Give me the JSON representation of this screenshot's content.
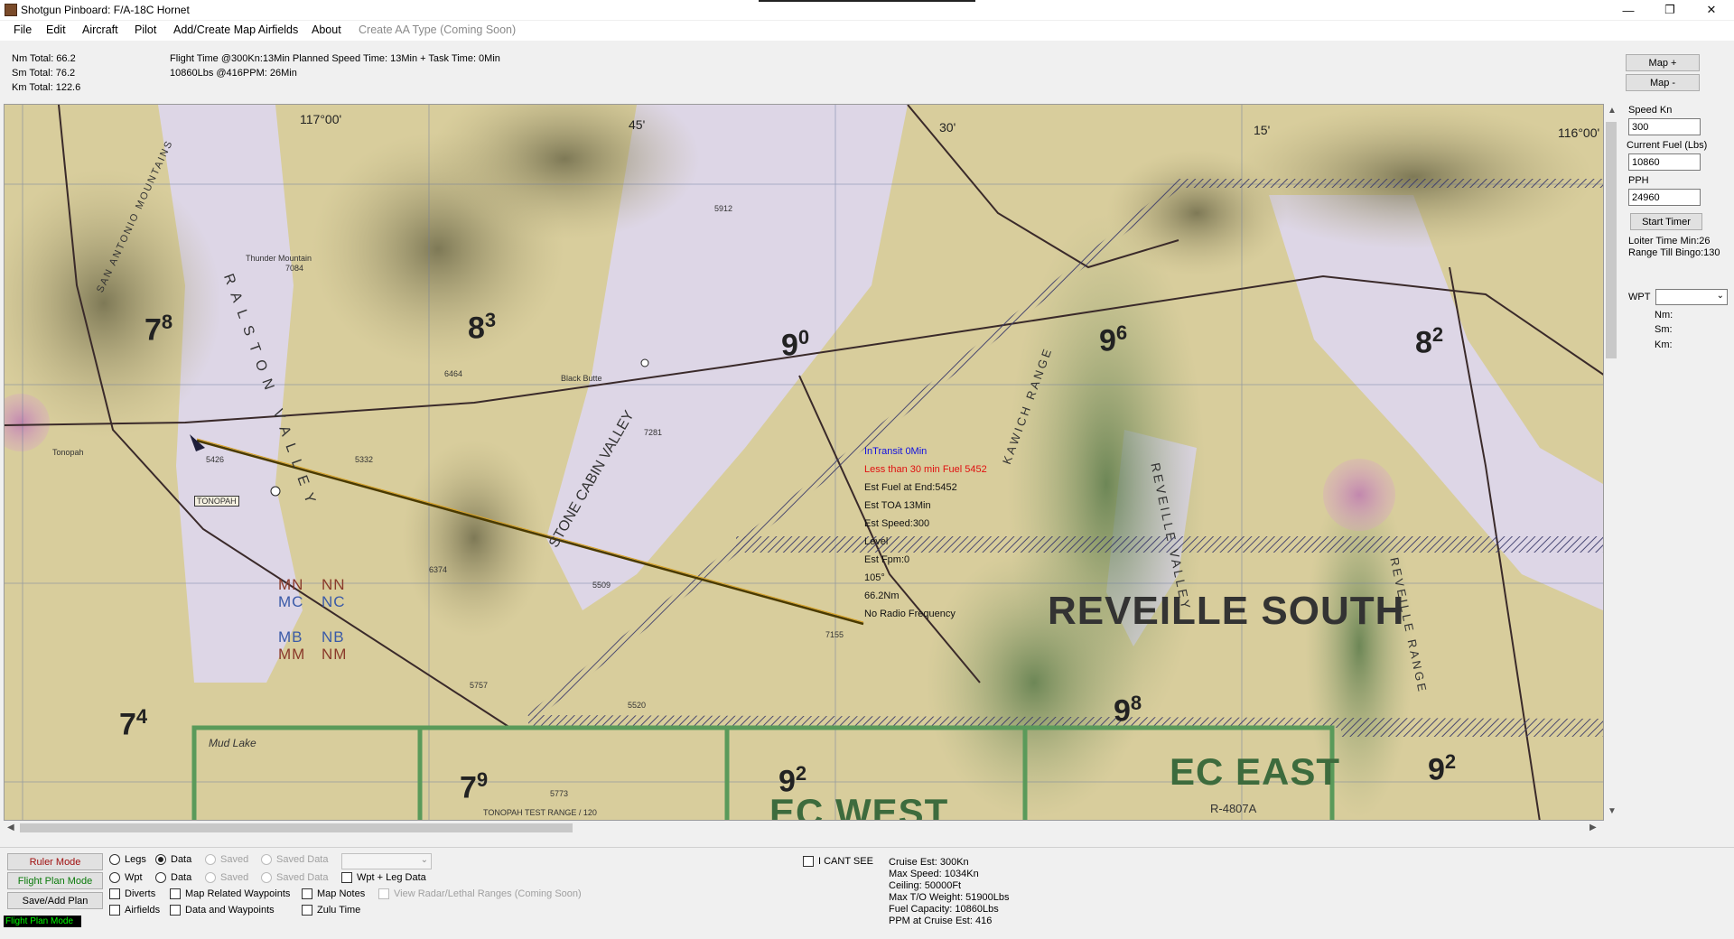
{
  "window": {
    "title": "Shotgun Pinboard: F/A-18C Hornet",
    "minimize": "—",
    "maximize": "❐",
    "close": "✕"
  },
  "menu": {
    "file": "File",
    "edit": "Edit",
    "aircraft": "Aircraft",
    "pilot": "Pilot",
    "airfields": "Add/Create Map Airfields",
    "about": "About",
    "create_aa": "Create AA Type (Coming Soon)"
  },
  "totals": {
    "nm": "Nm Total: 66.2",
    "sm": "Sm Total: 76.2",
    "km": "Km Total: 122.6",
    "flight_time": "Flight Time @300Kn:13Min Planned Speed Time: 13Min + Task Time: 0Min",
    "fuel_line": "10860Lbs @416PPM: 26Min"
  },
  "map": {
    "grid_numbers": [
      {
        "main": "7",
        "sup": "8"
      },
      {
        "main": "8",
        "sup": "3"
      },
      {
        "main": "9",
        "sup": "0"
      },
      {
        "main": "9",
        "sup": "6"
      },
      {
        "main": "8",
        "sup": "2"
      },
      {
        "main": "7",
        "sup": "4"
      },
      {
        "main": "7",
        "sup": "9"
      },
      {
        "main": "9",
        "sup": "2"
      },
      {
        "main": "9",
        "sup": "8"
      },
      {
        "main": "9",
        "sup": "2"
      }
    ],
    "area_reveille": "REVEILLE SOUTH",
    "area_ec_east": "EC EAST",
    "area_ec_west": "EC WEST",
    "restricted": "R-4807A",
    "coord_117": "117°00'",
    "coord_45": "45'",
    "coord_30": "30'",
    "coord_15": "15'",
    "coord_116": "116°00'",
    "tonopah": "TONOPAH",
    "tonopah_town": "Tonopah",
    "mud_lake": "Mud Lake",
    "mn": "MN",
    "nn": "NN",
    "mc": "MC",
    "nc": "NC",
    "mb": "MB",
    "nb": "NB",
    "mm": "MM",
    "nm": "NM",
    "stone_cabin": "STONE CABIN VALLEY",
    "ralston": "RALSTON VALLEY",
    "reveille_valley": "REVEILLE VALLEY",
    "reveille_range": "REVEILLE RANGE",
    "kawich": "KAWICH RANGE",
    "san_antonio": "SAN ANTONIO MOUNTAINS",
    "thunder_mtn": "Thunder Mountain",
    "black_butte": "Black Butte",
    "tonopah_test_range": "TONOPAH TEST RANGE / 120",
    "elev_7084": "7084",
    "elev_6464": "6464",
    "elev_7281": "7281",
    "elev_5332": "5332",
    "elev_5509": "5509",
    "elev_5757": "5757",
    "elev_5520": "5520",
    "elev_5912": "5912",
    "elev_7155": "7155",
    "elev_6374": "6374",
    "elev_5773": "5773",
    "elev_5426": "5426"
  },
  "info_overlay": {
    "in_transit": "InTransit 0Min",
    "fuel_warning": "Less than 30 min Fuel 5452",
    "est_fuel": "Est Fuel at End:5452",
    "est_toa": "Est TOA 13Min",
    "est_speed": "Est Speed:300",
    "level": "Level",
    "est_fpm": "Est Fpm:0",
    "heading": "105°",
    "distance": "66.2Nm",
    "radio": "No Radio Frequency"
  },
  "right_panel": {
    "map_plus": "Map +",
    "map_minus": "Map -",
    "speed_label": "Speed Kn",
    "speed_value": "300",
    "fuel_label": "Current Fuel (Lbs)",
    "fuel_value": "10860",
    "pph_label": "PPH",
    "pph_value": "24960",
    "start_timer": "Start Timer",
    "loiter": "Loiter Time Min:26",
    "range_bingo": "Range Till Bingo:130",
    "wpt_label": "WPT",
    "wpt_nm": "Nm:",
    "wpt_sm": "Sm:",
    "wpt_km": "Km:"
  },
  "bottom": {
    "ruler_mode": "Ruler Mode",
    "flight_plan_mode": "Flight Plan Mode",
    "save_add_plan": "Save/Add Plan",
    "status_mode": "Flight Plan Mode",
    "legs": "Legs",
    "data1": "Data",
    "saved1": "Saved",
    "saved_data1": "Saved Data",
    "wpt": "Wpt",
    "data2": "Data",
    "saved2": "Saved",
    "saved_data2": "Saved Data",
    "wpt_leg_data": "Wpt + Leg Data",
    "diverts": "Diverts",
    "map_related": "Map Related Waypoints",
    "map_notes": "Map Notes",
    "view_radar": "View Radar/Lethal Ranges (Coming Soon)",
    "airfields": "Airfields",
    "data_waypoints": "Data and Waypoints",
    "zulu_time": "Zulu Time",
    "i_cant_see": "I CANT SEE"
  },
  "aircraft_stats": {
    "cruise": "Cruise Est: 300Kn",
    "max_speed": "Max Speed: 1034Kn",
    "ceiling": "Ceiling: 50000Ft",
    "max_to": "Max T/O Weight: 51900Lbs",
    "fuel_capacity": "Fuel Capacity: 10860Lbs",
    "ppm": "PPM at Cruise Est: 416"
  },
  "colors": {
    "ruler_text": "#a01010",
    "flight_plan_text": "#0a7a0a",
    "fuel_warning": "#e01010",
    "in_transit": "#1010e0",
    "status_fg": "#00ff00",
    "status_bg": "#000000",
    "route_line": "#6b4e00"
  }
}
